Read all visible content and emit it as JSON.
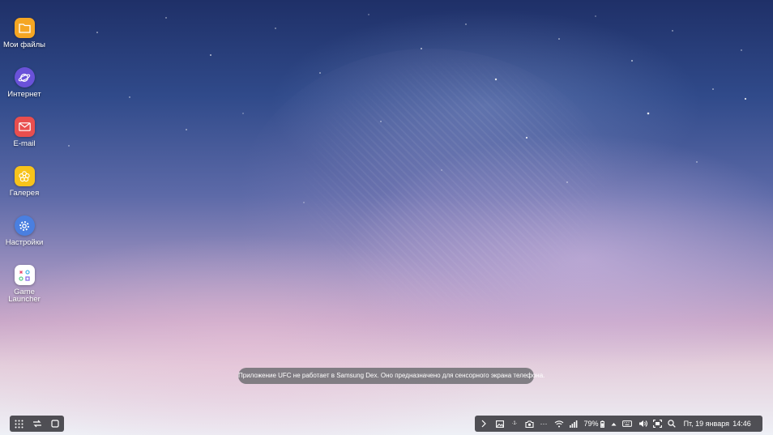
{
  "desktop": {
    "apps": [
      {
        "label": "Мои файлы",
        "icon": "folder-icon",
        "color": "#f5a623"
      },
      {
        "label": "Интернет",
        "icon": "internet-planet-icon",
        "color": "#6a52d9"
      },
      {
        "label": "E-mail",
        "icon": "mail-icon",
        "color": "#e94e4e"
      },
      {
        "label": "Галерея",
        "icon": "gallery-flower-icon",
        "color": "#f7c31b"
      },
      {
        "label": "Настройки",
        "icon": "gear-icon",
        "color": "#4a7fe0"
      },
      {
        "label": "Game\nLauncher",
        "icon": "game-launcher-icon",
        "color": "#ffffff"
      }
    ]
  },
  "toast": {
    "message": "Приложение UFC не работает в Samsung Dex. Оно предназначено для сенсорного экрана телефона."
  },
  "taskbar": {
    "left_buttons": [
      "apps-grid-icon",
      "recent-apps-icon",
      "home-square-icon"
    ],
    "tray": {
      "extra_icon_label": "·1·",
      "battery": "79%",
      "date": "Пт, 19 января",
      "time": "14:46"
    }
  }
}
